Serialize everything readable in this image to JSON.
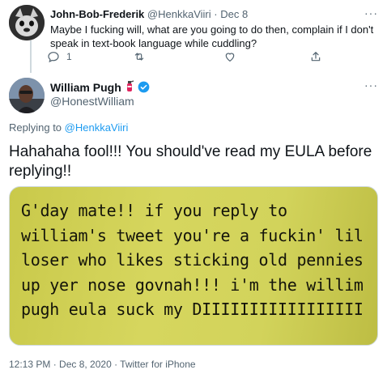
{
  "reply_tweet": {
    "name": "John-Bob-Frederik",
    "handle": "@HenkkaViiri",
    "date": "Dec 8",
    "separator": "·",
    "text": "Maybe I fucking will, what are you going to do then, complain if I don't speak in text-book language while cuddling?",
    "reply_count": "1",
    "more": "···"
  },
  "main_tweet": {
    "name": "William Pugh",
    "handle": "@HonestWilliam",
    "more": "···",
    "replying_prefix": "Replying to ",
    "replying_to": "@HenkkaViiri",
    "text": "Hahahaha fool!!! You should've read my EULA before replying!!",
    "media_text": "G'day mate!! if you reply to william's tweet you're a fuckin' lil loser who likes sticking old pennies up yer nose govnah!!! i'm the willim pugh eula suck my DIIIIIIIIIIIIIIIII",
    "timestamp": "12:13 PM · Dec 8, 2020 · Twitter for iPhone"
  },
  "colors": {
    "link": "#1d9bf0",
    "secondary_text": "#536471",
    "media_background": "#d2d35b"
  },
  "icons": [
    "reply-icon",
    "retweet-icon",
    "like-icon",
    "share-icon",
    "verified-icon",
    "fire-extinguisher-icon",
    "more-icon"
  ]
}
